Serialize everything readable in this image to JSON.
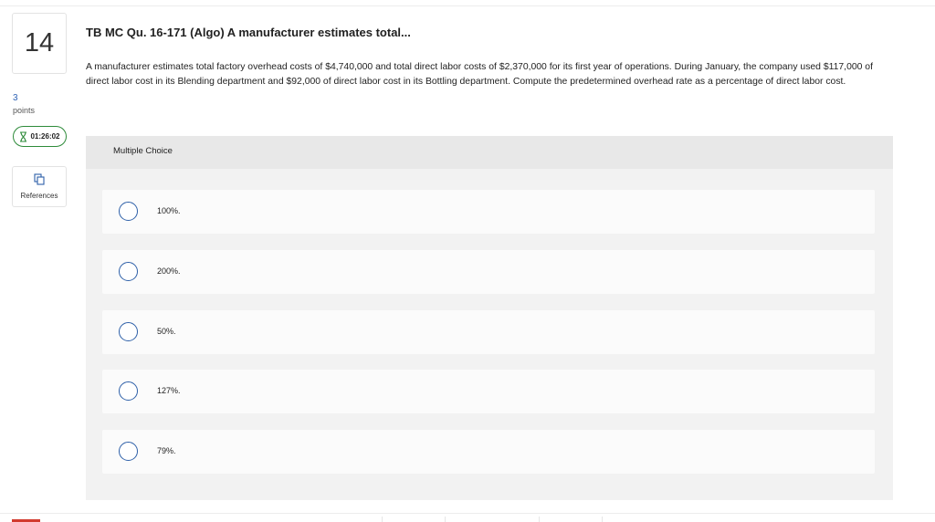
{
  "question": {
    "number": "14",
    "points_value": "3",
    "points_label": "points",
    "timer": "01:26:02",
    "references_label": "References",
    "title": "TB MC Qu. 16-171 (Algo) A manufacturer estimates total...",
    "body": "A manufacturer estimates total factory overhead costs of $4,740,000 and total direct labor costs of $2,370,000 for its first year of operations. During January, the company used $117,000 of direct labor cost in its Blending department and $92,000 of direct labor cost in its Bottling department. Compute the predetermined overhead rate as a percentage of direct labor cost."
  },
  "multiple_choice": {
    "label": "Multiple Choice",
    "options": [
      "100%.",
      "200%.",
      "50%.",
      "127%.",
      "79%."
    ]
  },
  "colors": {
    "timer_border": "#2e8b3a",
    "radio_border": "#2d5fa8",
    "points_text": "#2f63b5",
    "bottom_accent": "#d23a2e"
  },
  "icons": {
    "timer": "hourglass-icon",
    "references": "copy-pages-icon"
  }
}
